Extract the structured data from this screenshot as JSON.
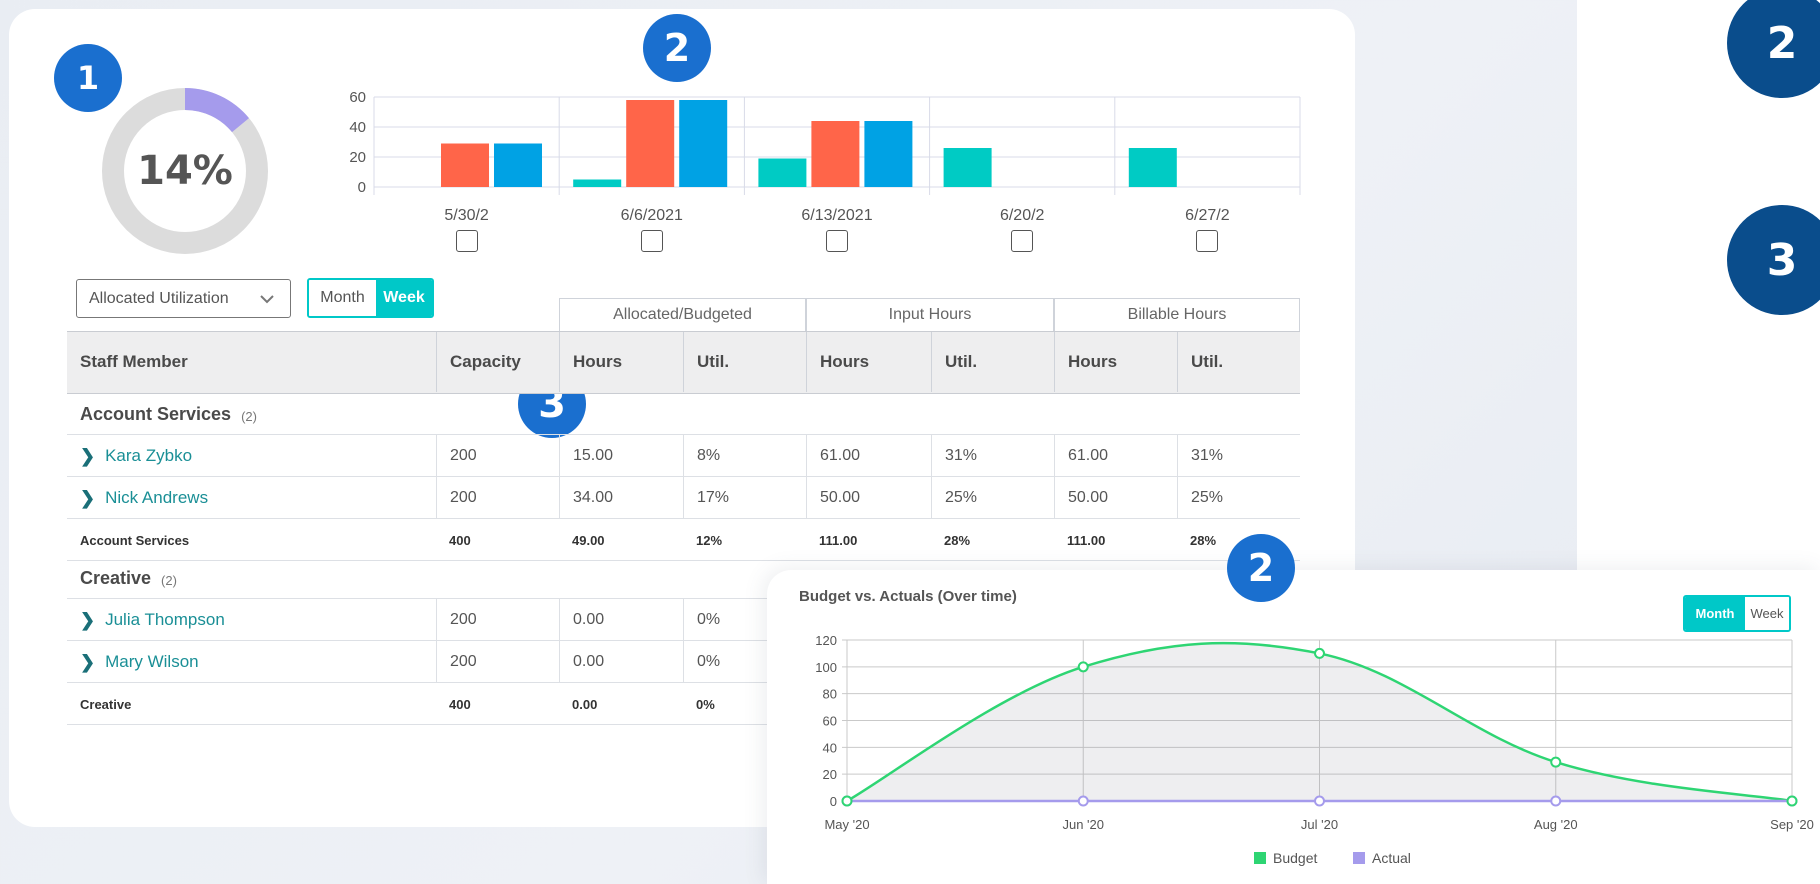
{
  "badges": {
    "donut_badge": "1",
    "bar_chart_badge": "2",
    "table_badge": "3",
    "line_chart_badge": "2",
    "side_badge_top": "2",
    "side_badge_bottom": "3"
  },
  "donut": {
    "label": "14%",
    "value": 0.14,
    "fill_color": "#a59bec",
    "track_color": "#dcdcdc"
  },
  "controls": {
    "metric_select": "Allocated Utilization",
    "period_toggle": {
      "options": [
        "Month",
        "Week"
      ],
      "selected": "Week"
    }
  },
  "table": {
    "group_headers": [
      "Allocated/Budgeted",
      "Input Hours",
      "Billable Hours"
    ],
    "columns": [
      "Staff Member",
      "Capacity",
      "Hours",
      "Util.",
      "Hours",
      "Util.",
      "Hours",
      "Util."
    ],
    "sections": [
      {
        "name": "Account Services",
        "count": "(2)",
        "rows": [
          {
            "member": "Kara Zybko",
            "cells": [
              "200",
              "15.00",
              "8%",
              "61.00",
              "31%",
              "61.00",
              "31%"
            ]
          },
          {
            "member": "Nick Andrews",
            "cells": [
              "200",
              "34.00",
              "17%",
              "50.00",
              "25%",
              "50.00",
              "25%"
            ]
          }
        ],
        "total": {
          "label": "Account Services",
          "cells": [
            "400",
            "49.00",
            "12%",
            "111.00",
            "28%",
            "111.00",
            "28%"
          ]
        }
      },
      {
        "name": "Creative",
        "count": "(2)",
        "rows": [
          {
            "member": "Julia Thompson",
            "cells": [
              "200",
              "0.00",
              "0%"
            ]
          },
          {
            "member": "Mary Wilson",
            "cells": [
              "200",
              "0.00",
              "0%"
            ]
          }
        ],
        "total": {
          "label": "Creative",
          "cells": [
            "400",
            "0.00",
            "0%"
          ]
        }
      }
    ]
  },
  "line_chart": {
    "title": "Budget vs. Actuals (Over time)",
    "toggle": {
      "options": [
        "Month",
        "Week"
      ],
      "selected": "Month"
    }
  },
  "chart_data": [
    {
      "type": "bar",
      "categories": [
        "5/30/2",
        "6/6/2021",
        "6/13/2021",
        "6/20/2",
        "6/27/2"
      ],
      "series": [
        {
          "color": "#00cbc4",
          "values": [
            0,
            5,
            19,
            26,
            26
          ]
        },
        {
          "color": "#ff6549",
          "values": [
            29,
            58,
            44,
            0,
            0
          ]
        },
        {
          "color": "#00a2e4",
          "values": [
            29,
            58,
            44,
            0,
            0
          ]
        }
      ],
      "ylim": [
        0,
        60
      ],
      "yticks": [
        0,
        20,
        40,
        60
      ],
      "grid": true
    },
    {
      "type": "line",
      "title": "Budget vs. Actuals (Over time)",
      "categories": [
        "May '20",
        "Jun '20",
        "Jul '20",
        "Aug '20",
        "Sep '20"
      ],
      "series": [
        {
          "name": "Budget",
          "color": "#2ed573",
          "values": [
            0,
            100,
            110,
            29,
            0
          ],
          "area": true
        },
        {
          "name": "Actual",
          "color": "#a59bec",
          "values": [
            0,
            0,
            0,
            0,
            0
          ]
        }
      ],
      "ylim": [
        0,
        120
      ],
      "yticks": [
        0,
        20,
        40,
        60,
        80,
        100,
        120
      ],
      "legend": "bottom",
      "grid": true
    }
  ]
}
